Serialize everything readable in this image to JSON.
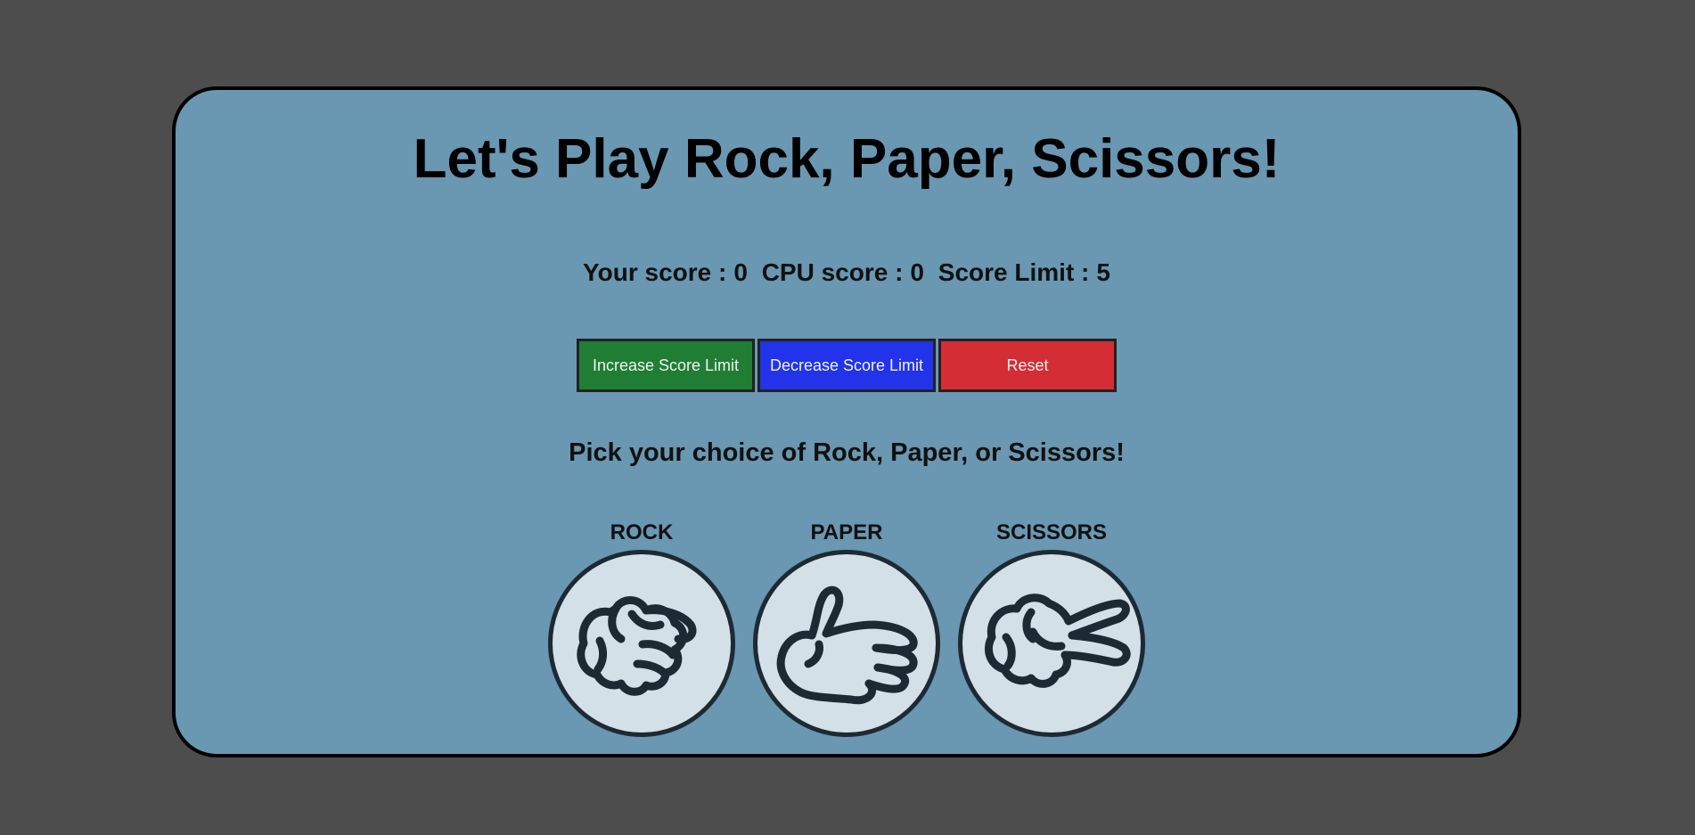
{
  "game": {
    "title": "Let's Play Rock, Paper, Scissors!",
    "score": {
      "player_label": "Your score :",
      "player_value": "0",
      "cpu_label": "CPU score :",
      "cpu_value": "0",
      "limit_label": "Score Limit :",
      "limit_value": "5"
    },
    "buttons": {
      "increase": "Increase Score Limit",
      "decrease": "Decrease Score Limit",
      "reset": "Reset"
    },
    "prompt": "Pick your choice of Rock, Paper, or Scissors!",
    "choices": [
      {
        "label": "ROCK",
        "icon": "rock-hand-icon"
      },
      {
        "label": "PAPER",
        "icon": "paper-hand-icon"
      },
      {
        "label": "SCISSORS",
        "icon": "scissors-hand-icon"
      }
    ]
  },
  "colors": {
    "page_bg": "#4d4d4d",
    "card_bg": "#6a97b1",
    "increase_btn": "#1f7e34",
    "decrease_btn": "#2233ea",
    "reset_btn": "#d42d35",
    "choice_circle_bg": "#d4e0e7"
  }
}
